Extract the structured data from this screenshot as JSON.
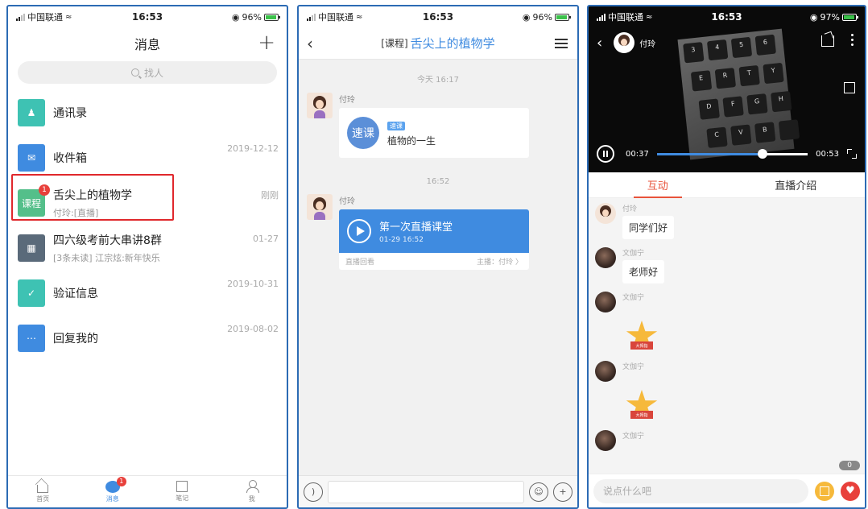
{
  "status_bar": {
    "carrier": "中国联通",
    "time": "16:53",
    "battery_p1": "96%",
    "battery_p2": "96%",
    "battery_p3": "97%"
  },
  "messages_screen": {
    "title": "消息",
    "search_placeholder": "找人",
    "items": [
      {
        "name": "通讯录",
        "sub": "",
        "date": "",
        "icon": "contacts-icon"
      },
      {
        "name": "收件箱",
        "sub": "",
        "date": "2019-12-12",
        "icon": "inbox-icon"
      },
      {
        "name": "舌尖上的植物学",
        "sub": "付玲:[直播]",
        "date": "刚刚",
        "icon_label": "课程",
        "badge": "1"
      },
      {
        "name": "四六级考前大串讲8群",
        "sub": "[3条未读] 江宗炫:新年快乐",
        "date": "01-27",
        "icon": "group-avatar"
      },
      {
        "name": "验证信息",
        "sub": "",
        "date": "2019-10-31",
        "icon": "shield-icon"
      },
      {
        "name": "回复我的",
        "sub": "",
        "date": "2019-08-02",
        "icon": "reply-icon"
      }
    ],
    "tabbar": [
      {
        "label": "首页",
        "icon": "home-icon"
      },
      {
        "label": "消息",
        "icon": "message-icon",
        "badge": "1"
      },
      {
        "label": "笔记",
        "icon": "note-icon"
      },
      {
        "label": "我",
        "icon": "me-icon"
      }
    ]
  },
  "chat_screen": {
    "title_tag": "[课程]",
    "title": "舌尖上的植物学",
    "time1": "今天 16:17",
    "sender1": "付玲",
    "card1_circle": "速课",
    "card1_tag": "速课",
    "card1_title": "植物的一生",
    "time2": "16:52",
    "sender2": "付玲",
    "card2_title": "第一次直播课堂",
    "card2_date": "01-29 16:52",
    "card2_left": "直播回看",
    "card2_right": "主播：付玲 〉"
  },
  "live_screen": {
    "host": "付玲",
    "elapsed": "00:37",
    "total": "00:53",
    "progress": 0.7,
    "keys": [
      "3",
      "4",
      "5",
      "6",
      "E",
      "R",
      "T",
      "Y",
      "D",
      "F",
      "G",
      "H",
      "C",
      "V",
      "B",
      ""
    ],
    "tab_active": "互动",
    "tab_other": "直播介绍",
    "feed": [
      {
        "name": "付玲",
        "text": "同学们好",
        "av": "girl"
      },
      {
        "name": "文伽宁",
        "text": "老师好",
        "av": "dark"
      },
      {
        "name": "文伽宁",
        "text": "",
        "av": "dark",
        "sticker": "大拇指"
      },
      {
        "name": "文伽宁",
        "text": "",
        "av": "dark",
        "sticker": "大拇指"
      },
      {
        "name": "文伽宁",
        "text": "",
        "av": "dark"
      }
    ],
    "count": "0",
    "input_placeholder": "说点什么吧"
  }
}
